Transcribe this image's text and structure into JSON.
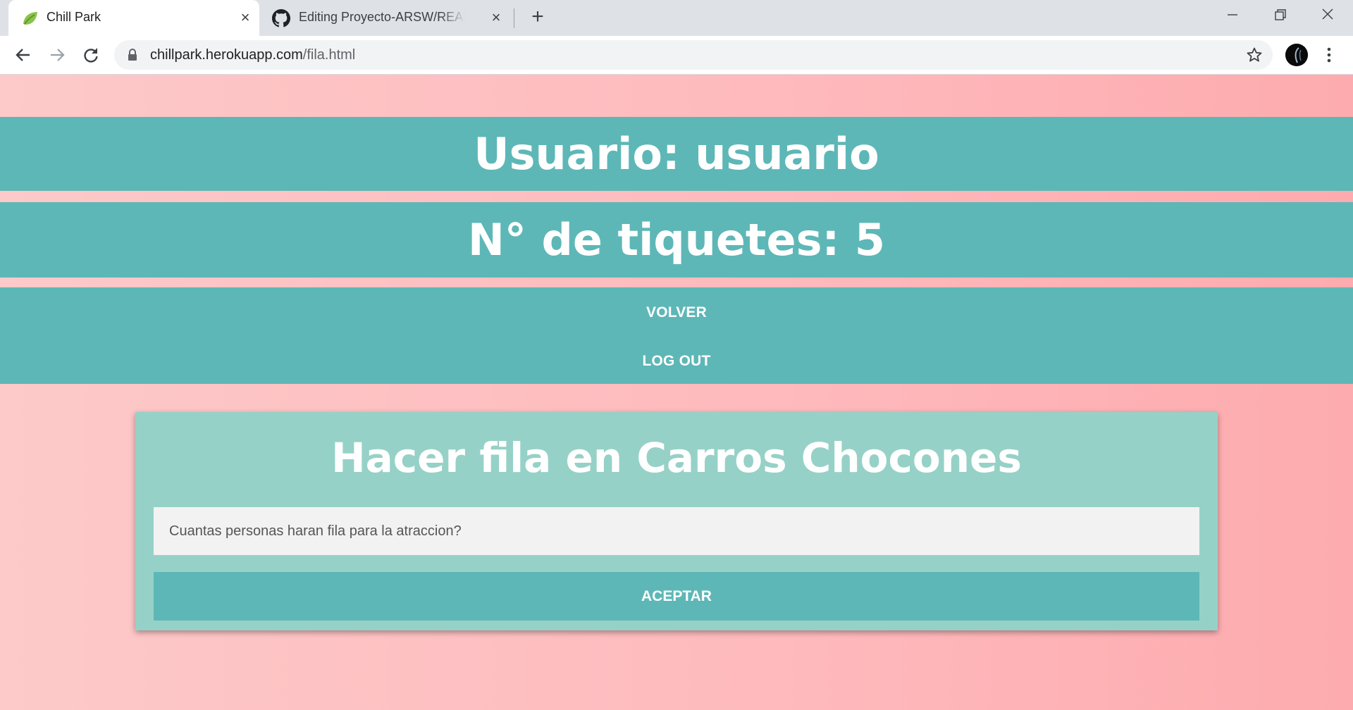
{
  "browser": {
    "tabs": [
      {
        "title": "Chill Park",
        "active": true,
        "icon": "spring-leaf-icon"
      },
      {
        "title": "Editing Proyecto-ARSW/README.md",
        "active": false,
        "icon": "github-icon"
      }
    ],
    "url_host": "chillpark.herokuapp.com",
    "url_path": "/fila.html"
  },
  "page": {
    "user_banner": "Usuario: usuario",
    "tickets_banner": "N° de tiquetes: 5",
    "nav": {
      "back_label": "VOLVER",
      "logout_label": "LOG OUT"
    },
    "queue_form": {
      "title": "Hacer fila en Carros Chocones",
      "input_placeholder": "Cuantas personas haran fila para la atraccion?",
      "input_value": "",
      "submit_label": "ACEPTAR"
    }
  },
  "colors": {
    "teal": "#5eb7b7",
    "card": "#96d1c7",
    "pink": "#fdc9c9"
  }
}
